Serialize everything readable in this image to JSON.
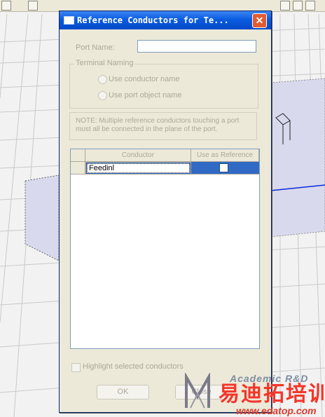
{
  "background": {
    "description_colors": {
      "grid": "#c7c7c7",
      "box_fill": "#d7d9ec"
    }
  },
  "dialog": {
    "title": "Reference Conductors for Te...",
    "close_glyph": "✕",
    "port_name_label": "Port Name:",
    "port_name_value": "",
    "terminal_naming": {
      "title": "Terminal Naming",
      "option_conductor": "Use conductor name",
      "option_port": "Use port object name"
    },
    "note": "NOTE: Multiple reference conductors touching a port must all be connected in the plane of the port.",
    "grid": {
      "headers": [
        "Conductor",
        "Use as Reference"
      ],
      "rows": [
        {
          "conductor": "Feedinl",
          "use_as_reference": false
        }
      ]
    },
    "highlight_label": "Highlight selected conductors",
    "ok_label": "OK",
    "close_label": "Close"
  },
  "watermark": {
    "line1": "Academic R&D",
    "line2": "易迪拓培训",
    "line3": "www.edatop.com"
  }
}
